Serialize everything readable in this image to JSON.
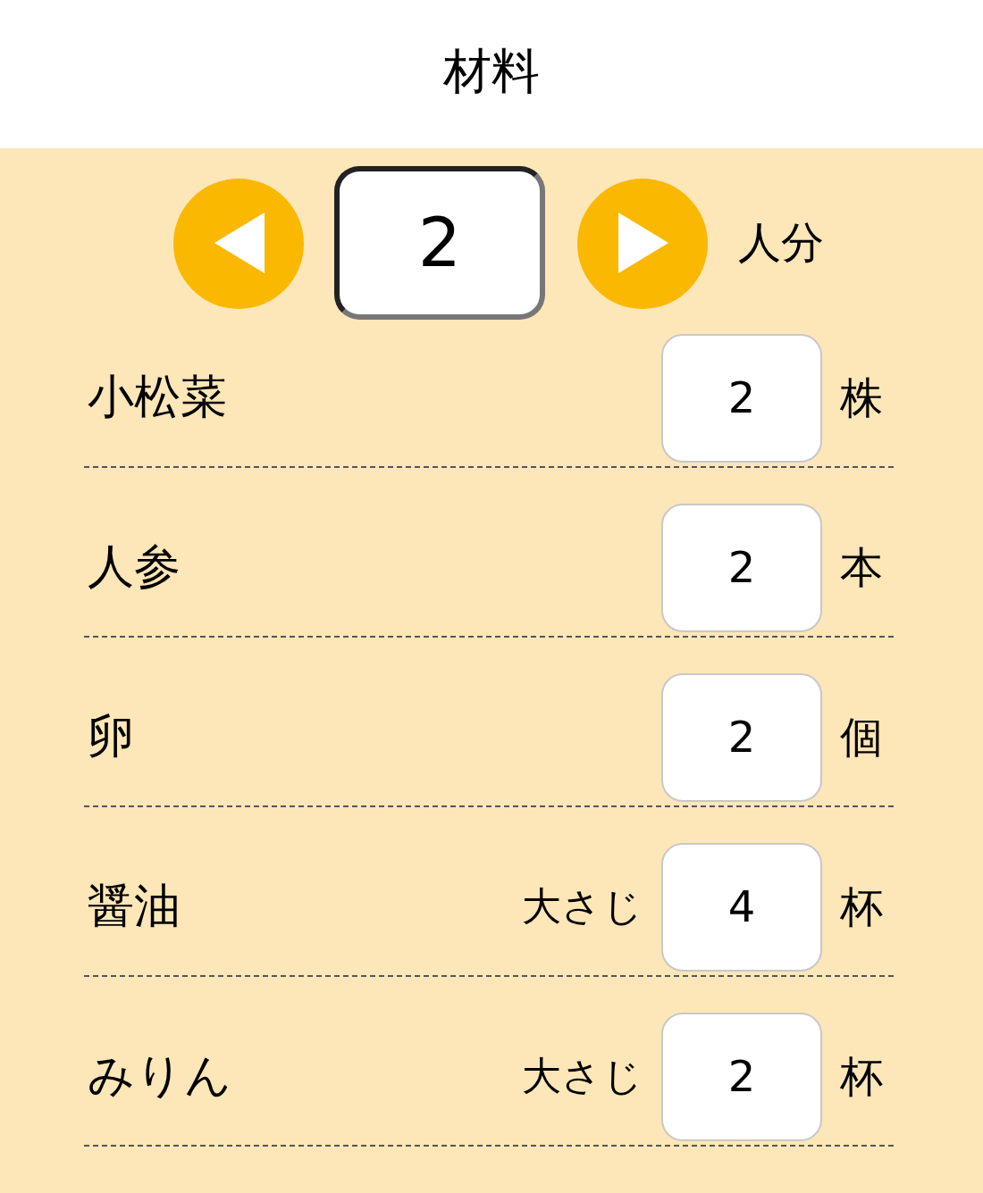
{
  "title": "材料",
  "servings": {
    "value": "2",
    "unit": "人分"
  },
  "ingredients": [
    {
      "name": "小松菜",
      "amount": "2",
      "unit": "株"
    },
    {
      "name": "人参",
      "amount": "2",
      "unit": "本"
    },
    {
      "name": "卵",
      "amount": "2",
      "unit": "個"
    },
    {
      "name": "醤油",
      "prefix": "大さじ",
      "amount": "4",
      "unit": "杯"
    },
    {
      "name": "みりん",
      "prefix": "大さじ",
      "amount": "2",
      "unit": "杯"
    }
  ]
}
